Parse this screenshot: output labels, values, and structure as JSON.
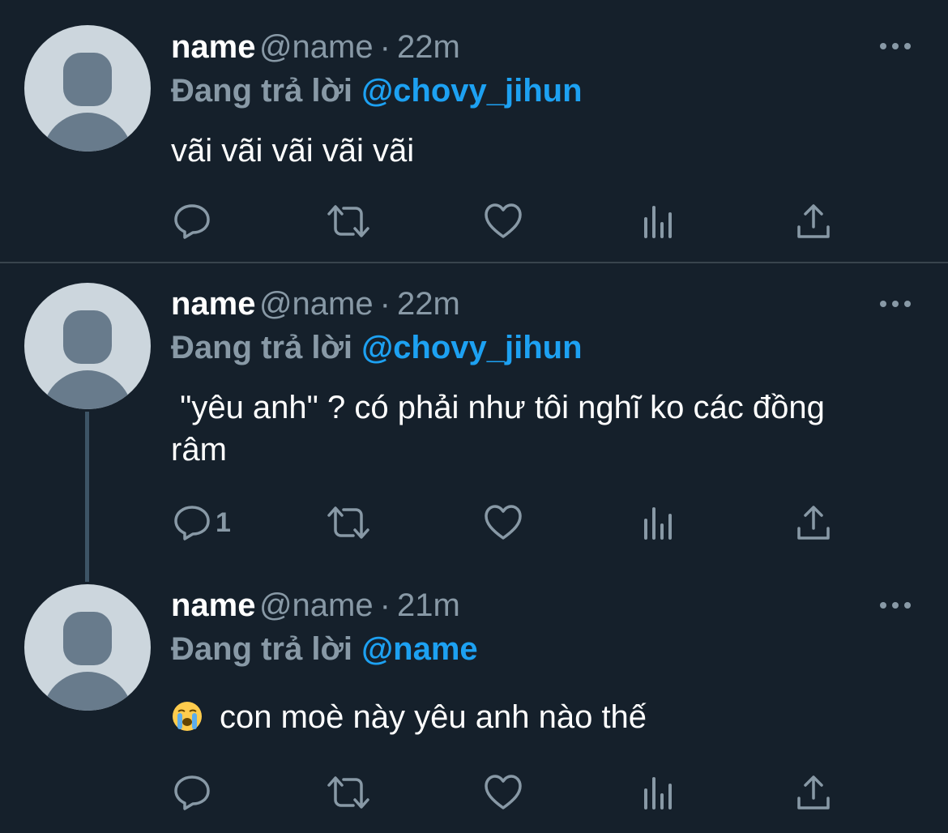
{
  "tweets": [
    {
      "name": "name",
      "handle": "@name",
      "separator": "·",
      "time": "22m",
      "replying_prefix": "Đang trả lời",
      "replying_to": "@chovy_jihun",
      "text": "vãi vãi vãi vãi vãi",
      "reply_count": ""
    },
    {
      "name": "name",
      "handle": "@name",
      "separator": "·",
      "time": "22m",
      "replying_prefix": "Đang trả lời",
      "replying_to": "@chovy_jihun",
      "text": " \"yêu anh\" ? có phải như tôi nghĩ ko các đồng râm",
      "reply_count": "1"
    },
    {
      "name": "name",
      "handle": "@name",
      "separator": "·",
      "time": "21m",
      "replying_prefix": "Đang trả lời",
      "replying_to": "@name",
      "text": "con moè này yêu anh nào thế",
      "emoji": "loudly-crying-face",
      "reply_count": ""
    }
  ],
  "icons": {
    "reply": "reply-icon",
    "retweet": "retweet-icon",
    "like": "heart-icon",
    "analytics": "analytics-icon",
    "share": "share-icon",
    "more": "more-icon"
  },
  "colors": {
    "background": "#15202b",
    "mention": "#1da1f2",
    "secondary_text": "#8899a6",
    "divider": "#38444d"
  }
}
